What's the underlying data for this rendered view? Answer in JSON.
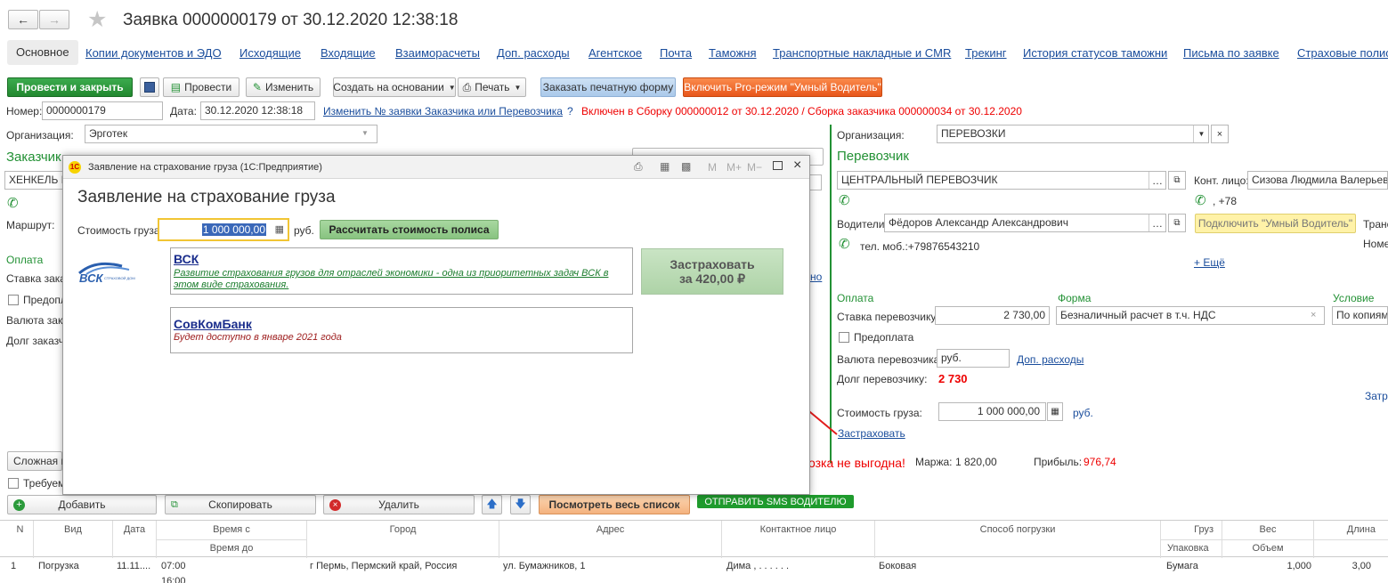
{
  "window": {
    "title": "Заявка 0000000179 от 30.12.2020 12:38:18"
  },
  "tabs": [
    "Основное",
    "Копии документов и ЭДО",
    "Исходящие",
    "Входящие",
    "Взаиморасчеты",
    "Доп. расходы",
    "Агентское",
    "Почта",
    "Таможня",
    "Транспортные накладные и CMR",
    "Трекинг",
    "История статусов таможни",
    "Письма по заявке",
    "Страховые полис"
  ],
  "toolbar": {
    "post_close": "Провести и закрыть",
    "post": "Провести",
    "edit": "Изменить",
    "create_based": "Создать на основании",
    "print": "Печать",
    "order_print_form": "Заказать печатную форму",
    "pro_mode": "Включить Pro-режим \"Умный Водитель\""
  },
  "header": {
    "number_label": "Номер:",
    "number_value": "0000000179",
    "date_label": "Дата:",
    "date_value": "30.12.2020 12:38:18",
    "change_link": "Изменить № заявки Заказчика или Перевозчика",
    "help": "?",
    "notice": "Включен в Сборку 000000012 от 30.12.2020 / Сборка заказчика 000000034 от 30.12.2020"
  },
  "left": {
    "org_label": "Организация:",
    "org_value": "Эрготек",
    "customer_title": "Заказчик",
    "customer_value": "ХЕНКЕЛЬ Б",
    "route_label": "Маршрут:",
    "payment_title": "Оплата",
    "rate_label": "Ставка зака",
    "prepay_label": "Предопла",
    "currency_label": "Валюта закa",
    "debt_label": "Долг заказч",
    "complex_btn": "Сложная п",
    "required_label": "Требуем"
  },
  "right": {
    "org_label": "Организация:",
    "org_value": "ПЕРЕВОЗКИ",
    "carrier_title": "Перевозчик",
    "carrier_value": "ЦЕНТРАЛЬНЫЙ ПЕРЕВОЗЧИК",
    "contact_label": "Конт. лицо:",
    "contact_value": "Сизова Людмила Валерьевна",
    "contact_phone": ", +78",
    "drivers_label": "Водители:",
    "drivers_value": "Фёдоров Александр Александрович",
    "smart_driver_btn": "Подключить \"Умный Водитель\"",
    "trans_label": "Транс",
    "nomer_label": "Номе",
    "driver_phone": "тел. моб.:+79876543210",
    "more_link": "+ Ещё",
    "payment_title": "Оплата",
    "form_title": "Форма",
    "condition_title": "Условие",
    "rate_label": "Ставка перевозчику:",
    "rate_value": "2 730,00",
    "form_value": "Безналичный расчет в т.ч. НДС",
    "condition_value": "По копиям н",
    "prepay_label": "Предоплата",
    "currency_label": "Валюта перевозчика:",
    "currency_value": "руб.",
    "extra_link": "Доп. расходы",
    "debt_label": "Долг перевозчику:",
    "debt_value": "2 730",
    "zatr_label": "Затра",
    "cargo_cost_label": "Стоимость груза:",
    "cargo_cost_value": "1 000 000,00",
    "cargo_cost_unit": "руб.",
    "insure_link": "Застраховать",
    "unprofitable": "озка не выгодна!",
    "margin_label": "Маржа:",
    "margin_value": "1 820,00",
    "profit_label": "Прибыль:",
    "profit_value": "976,74"
  },
  "modal": {
    "title": "Заявление на страхование груза  (1С:Предприятие)",
    "heading": "Заявление на страхование груза",
    "cost_label": "Стоимость груза:",
    "cost_value": "1 000 000,00",
    "cost_unit": "руб.",
    "calc_btn": "Рассчитать стоимость полиса",
    "insurers": [
      {
        "name": "ВСК",
        "desc": "Развитие страхования грузов для отраслей экономики - одна из приоритетных задач ВСК в этом виде страхования."
      },
      {
        "name": "СовКомБанк",
        "desc": "Будет доступно в январе 2021 года"
      }
    ],
    "vsk_logo": "ВСК",
    "vsk_logo_sub": "СТРАХОВОЙ ДОМ",
    "insure_btn_line1": "Застраховать",
    "insure_btn_line2": "за 420,00 ₽",
    "title_icons": [
      "M",
      "M+",
      "M−"
    ]
  },
  "grid_toolbar": {
    "add": "Добавить",
    "copy": "Скопировать",
    "delete": "Удалить",
    "view_all": "Посмотреть весь список",
    "sms": "ОТПРАВИТЬ SMS ВОДИТЕЛЮ"
  },
  "grid": {
    "headers": {
      "n": "N",
      "type": "Вид",
      "date": "Дата",
      "time_from": "Время с",
      "time_to": "Время до",
      "city": "Город",
      "address": "Адрес",
      "contact": "Контактное лицо",
      "load": "Способ погрузки",
      "cargo": "Груз",
      "pack": "Упаковка",
      "weight": "Вес",
      "volume": "Объем",
      "length": "Длина"
    },
    "rows": [
      {
        "n": "1",
        "type": "Погрузка",
        "date": "11.11....",
        "time_from": "07:00",
        "time_to": "16:00",
        "city": "г Пермь,  Пермский край, Россия",
        "address": "ул. Бумажников, 1",
        "contact": "Дима , . . . . . .",
        "load": "Боковая",
        "cargo": "Бумага",
        "weight": "1,000",
        "length": "3,00"
      }
    ]
  }
}
